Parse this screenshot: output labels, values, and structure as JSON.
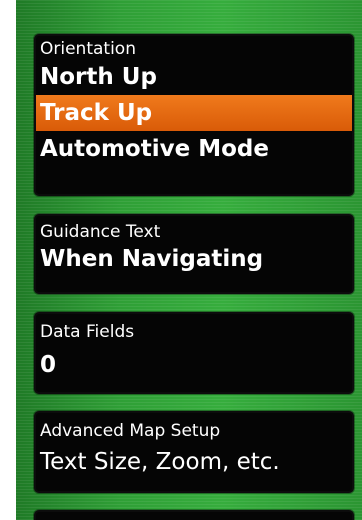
{
  "orientation": {
    "title": "Orientation",
    "options": [
      "North Up",
      "Track Up",
      "Automotive Mode"
    ],
    "selected_index": 1
  },
  "guidance": {
    "title": "Guidance Text",
    "value": "When Navigating"
  },
  "data_fields": {
    "title": "Data Fields",
    "value": "0"
  },
  "advanced": {
    "title": "Advanced Map Setup",
    "value": "Text Size, Zoom, etc."
  },
  "colors": {
    "background_green": "#2f9f36",
    "panel_black": "#050505",
    "selected_orange": "#e8690f",
    "text_white": "#ffffff"
  }
}
